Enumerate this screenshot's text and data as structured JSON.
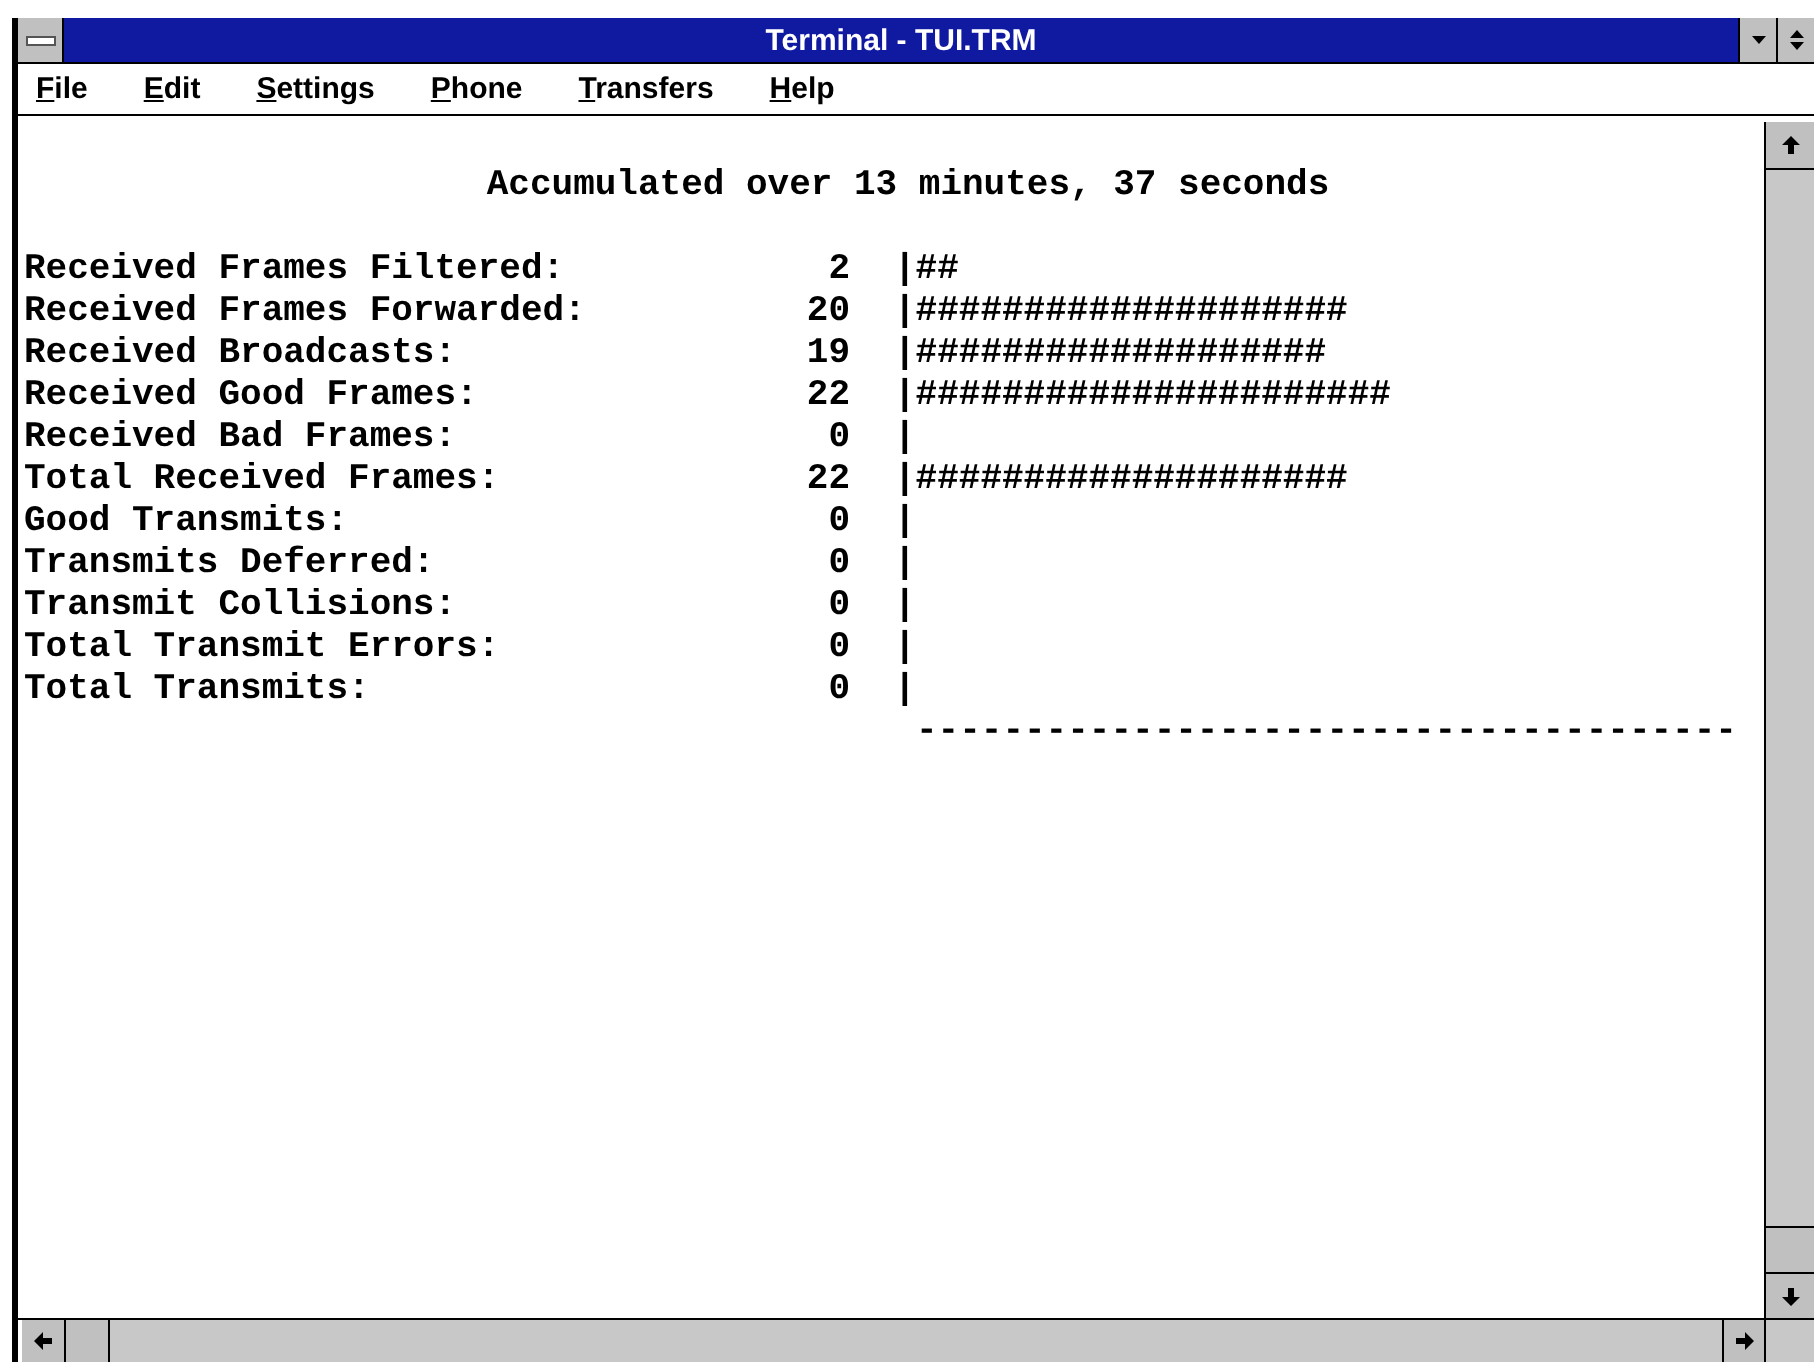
{
  "window": {
    "title": "Terminal - TUI.TRM"
  },
  "menu": [
    "File",
    "Edit",
    "Settings",
    "Phone",
    "Transfers",
    "Help"
  ],
  "terminal": {
    "heading": "Accumulated over 13 minutes, 37 seconds",
    "rows": [
      {
        "label": "Received Frames Filtered:",
        "value": "2",
        "bar": "|##"
      },
      {
        "label": "Received Frames Forwarded:",
        "value": "20",
        "bar": "|####################"
      },
      {
        "label": "Received Broadcasts:",
        "value": "19",
        "bar": "|###################"
      },
      {
        "label": "Received Good Frames:",
        "value": "22",
        "bar": "|######################"
      },
      {
        "label": "Received Bad Frames:",
        "value": "0",
        "bar": "|"
      },
      {
        "label": "Total Received Frames:",
        "value": "22",
        "bar": "|####################"
      },
      {
        "label": "Good Transmits:",
        "value": "0",
        "bar": "|"
      },
      {
        "label": "Transmits Deferred:",
        "value": "0",
        "bar": "|"
      },
      {
        "label": "Transmit Collisions:",
        "value": "0",
        "bar": "|"
      },
      {
        "label": "Total Transmit Errors:",
        "value": "0",
        "bar": "|"
      },
      {
        "label": "Total Transmits:",
        "value": "0",
        "bar": "|"
      }
    ],
    "dashes": "--------------------------------------"
  }
}
